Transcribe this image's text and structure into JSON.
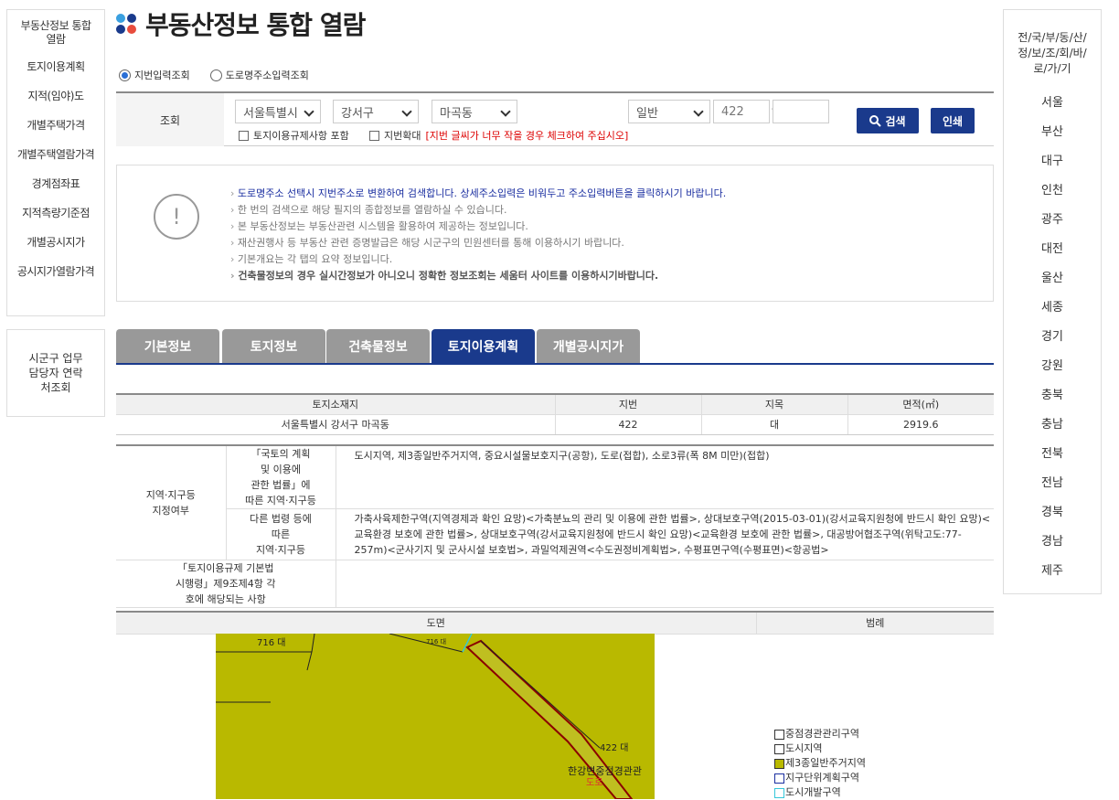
{
  "left_nav": {
    "items": [
      "부동산정보 통합 열람",
      "토지이용계획",
      "지적(임야)도",
      "개별주택가격",
      "개별주택열람가격",
      "경계점좌표",
      "지적측량기준점",
      "개별공시지가",
      "공시지가열람가격"
    ],
    "contact": "시군구 업무담당자 연락처조회"
  },
  "right_nav": {
    "title": "전/국/부/동/산/정/보/조/회/바/로/가/기",
    "items": [
      "서울",
      "부산",
      "대구",
      "인천",
      "광주",
      "대전",
      "울산",
      "세종",
      "경기",
      "강원",
      "충북",
      "충남",
      "전북",
      "전남",
      "경북",
      "경남",
      "제주"
    ]
  },
  "page_title": "부동산정보 통합 열람",
  "radios": {
    "jibun": "지번입력조회",
    "road": "도로명주소입력조회",
    "selected": "jibun"
  },
  "search": {
    "label": "조회",
    "sido": "서울특별시",
    "sigungu": "강서구",
    "dong": "마곡동",
    "type": "일반",
    "main_no": "422",
    "sub_no": "",
    "dash": "-",
    "check1": "토지이용규제사항 포함",
    "check2": "지번확대",
    "warn": "[지번 글씨가 너무 작을 경우 체크하여 주십시오]",
    "search_btn": "검색",
    "print_btn": "인쇄"
  },
  "notice": {
    "icon": "!",
    "lines": [
      "도로명주소 선택시 지번주소로 변환하여 검색합니다. 상세주소입력은 비워두고 주소입력버튼을 클릭하시기 바랍니다.",
      "한 번의 검색으로 해당 필지의 종합정보를 열람하실 수 있습니다.",
      "본 부동산정보는 부동산관련 시스템을 활용하여 제공하는 정보입니다.",
      "재산권행사 등 부동산 관련 증명발급은 해당 시군구의 민원센터를 통해 이용하시기 바랍니다.",
      "기본개요는 각 탭의 요약 정보입니다.",
      "건축물정보의 경우 실시간정보가 아니오니 정확한 정보조회는 세움터 사이트를 이용하시기바랍니다."
    ]
  },
  "tabs": [
    "기본정보",
    "토지정보",
    "건축물정보",
    "토지이용계획",
    "개별공시지가"
  ],
  "active_tab": "토지이용계획",
  "land_table": {
    "headers": [
      "토지소재지",
      "지번",
      "지목",
      "면적(㎡)"
    ],
    "row": [
      "서울특별시 강서구 마곡동",
      "422",
      "대",
      "2919.6"
    ]
  },
  "zone": {
    "label": "지역·지구등\n지정여부",
    "sub1_label": "「국토의 계획\n및 이용에\n관한 법률」에\n따른 지역·지구등",
    "sub1_value": "도시지역, 제3종일반주거지역, 중요시설물보호지구(공항), 도로(접합), 소로3류(폭 8M 미만)(접합)",
    "sub2_label": "다른 법령 등에\n따른\n지역·지구등",
    "sub2_value": "가축사육제한구역(지역경제과 확인 요망)<가축분뇨의 관리 및 이용에 관한 법률>, 상대보호구역(2015-03-01)(강서교육지원청에 반드시 확인 요망)<교육환경 보호에 관한 법률>, 상대보호구역(강서교육지원청에 반드시 확인 요망)<교육환경 보호에 관한 법률>, 대공방어협조구역(위탁고도:77-257m)<군사기지 및 군사시설 보호법>, 과밀억제권역<수도권정비계획법>, 수평표면구역(수평표면)<항공법>",
    "sub3_label": "「토지이용규제 기본법\n시행령」제9조제4항 각\n호에 해당되는 사항",
    "sub3_value": ""
  },
  "map_header": {
    "map": "도면",
    "legend": "범례"
  },
  "map_labels": [
    "716 대",
    "716 대",
    "422 대",
    "한강변중점경관관",
    "도로"
  ],
  "legend": [
    {
      "label": "중점경관관리구역",
      "color": "#ffffff",
      "border": "#333333"
    },
    {
      "label": "도시지역",
      "color": "#ffffff",
      "border": "#333333"
    },
    {
      "label": "제3종일반주거지역",
      "color": "#b9b900",
      "border": "#333333"
    },
    {
      "label": "지구단위계획구역",
      "color": "#ffffff",
      "border": "#1a2ea0"
    },
    {
      "label": "도시개발구역",
      "color": "#ffffff",
      "border": "#35c7d9"
    }
  ],
  "colors": {
    "accent": "#1a3a8c",
    "dot1": "#3aa0e0",
    "dot2": "#1a3a8c",
    "dot3": "#1a3a8c",
    "dot4": "#e84c3d"
  }
}
